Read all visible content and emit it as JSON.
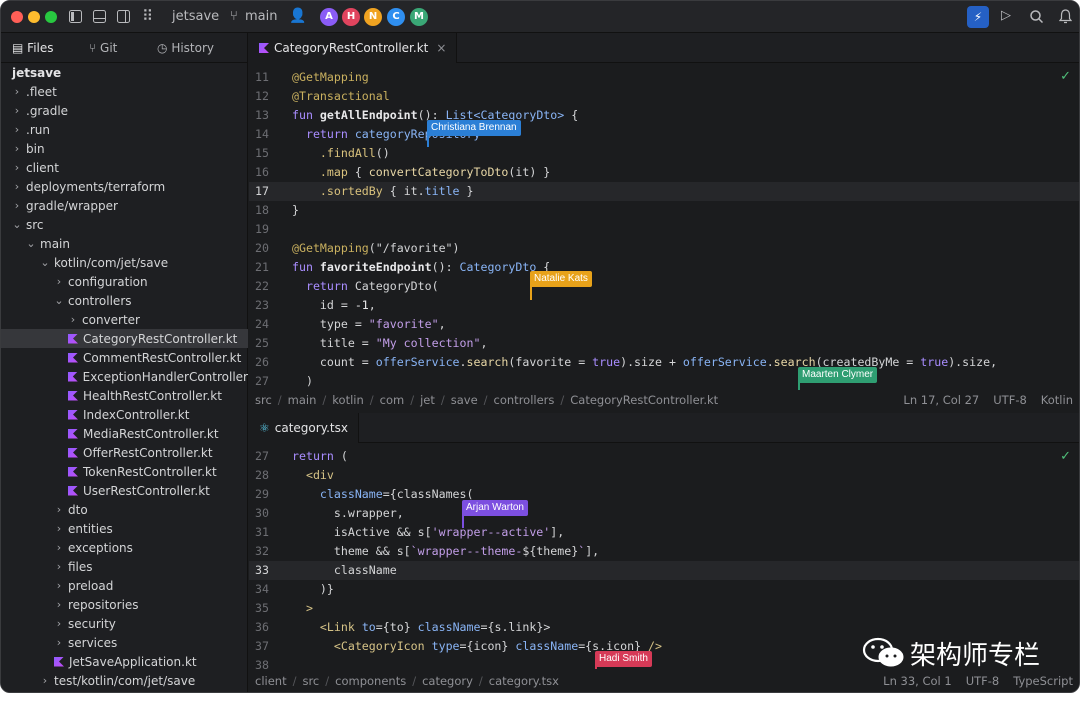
{
  "titlebar": {
    "project": "jetsave",
    "branch": "main",
    "avatars": [
      {
        "letter": "A",
        "color": "#8a5cf6"
      },
      {
        "letter": "H",
        "color": "#e0445e"
      },
      {
        "letter": "N",
        "color": "#f0a321"
      },
      {
        "letter": "C",
        "color": "#2f8ff0"
      },
      {
        "letter": "M",
        "color": "#3aa776"
      }
    ]
  },
  "sidebar": {
    "tabs": [
      "Files",
      "Git",
      "History"
    ],
    "tree": [
      {
        "label": "jetsave",
        "depth": 0,
        "type": "root"
      },
      {
        "label": ".fleet",
        "depth": 0,
        "type": "folder",
        "open": false
      },
      {
        "label": ".gradle",
        "depth": 0,
        "type": "folder",
        "open": false
      },
      {
        "label": ".run",
        "depth": 0,
        "type": "folder",
        "open": false
      },
      {
        "label": "bin",
        "depth": 0,
        "type": "folder",
        "open": false
      },
      {
        "label": "client",
        "depth": 0,
        "type": "folder",
        "open": false
      },
      {
        "label": "deployments/terraform",
        "depth": 0,
        "type": "folder",
        "open": false
      },
      {
        "label": "gradle/wrapper",
        "depth": 0,
        "type": "folder",
        "open": false
      },
      {
        "label": "src",
        "depth": 0,
        "type": "folder",
        "open": true
      },
      {
        "label": "main",
        "depth": 1,
        "type": "folder",
        "open": true
      },
      {
        "label": "kotlin/com/jet/save",
        "depth": 2,
        "type": "folder",
        "open": true
      },
      {
        "label": "configuration",
        "depth": 3,
        "type": "folder",
        "open": false
      },
      {
        "label": "controllers",
        "depth": 3,
        "type": "folder",
        "open": true
      },
      {
        "label": "converter",
        "depth": 4,
        "type": "folder",
        "open": false
      },
      {
        "label": "CategoryRestController.kt",
        "depth": 4,
        "type": "kt",
        "selected": true
      },
      {
        "label": "CommentRestController.kt",
        "depth": 4,
        "type": "kt"
      },
      {
        "label": "ExceptionHandlerController",
        "depth": 4,
        "type": "kt"
      },
      {
        "label": "HealthRestController.kt",
        "depth": 4,
        "type": "kt"
      },
      {
        "label": "IndexController.kt",
        "depth": 4,
        "type": "kt"
      },
      {
        "label": "MediaRestController.kt",
        "depth": 4,
        "type": "kt"
      },
      {
        "label": "OfferRestController.kt",
        "depth": 4,
        "type": "kt"
      },
      {
        "label": "TokenRestController.kt",
        "depth": 4,
        "type": "kt"
      },
      {
        "label": "UserRestController.kt",
        "depth": 4,
        "type": "kt"
      },
      {
        "label": "dto",
        "depth": 3,
        "type": "folder",
        "open": false
      },
      {
        "label": "entities",
        "depth": 3,
        "type": "folder",
        "open": false
      },
      {
        "label": "exceptions",
        "depth": 3,
        "type": "folder",
        "open": false
      },
      {
        "label": "files",
        "depth": 3,
        "type": "folder",
        "open": false
      },
      {
        "label": "preload",
        "depth": 3,
        "type": "folder",
        "open": false
      },
      {
        "label": "repositories",
        "depth": 3,
        "type": "folder",
        "open": false
      },
      {
        "label": "security",
        "depth": 3,
        "type": "folder",
        "open": false
      },
      {
        "label": "services",
        "depth": 3,
        "type": "folder",
        "open": false
      },
      {
        "label": "JetSaveApplication.kt",
        "depth": 3,
        "type": "kt"
      },
      {
        "label": "test/kotlin/com/jet/save",
        "depth": 2,
        "type": "folder",
        "open": false
      }
    ]
  },
  "pane1": {
    "tab": "CategoryRestController.kt",
    "lines": [
      {
        "n": "11",
        "segs": [
          [
            "@GetMapping",
            "a"
          ]
        ]
      },
      {
        "n": "12",
        "segs": [
          [
            "@Transactional",
            "a"
          ]
        ]
      },
      {
        "n": "13",
        "segs": [
          [
            "fun ",
            "k"
          ],
          [
            "getAllEndpoint",
            "fn"
          ],
          [
            "(): ",
            ""
          ],
          [
            "List<CategoryDto>",
            "ty"
          ],
          [
            " {",
            ""
          ]
        ]
      },
      {
        "n": "14",
        "segs": [
          [
            "  return ",
            "k"
          ],
          [
            "categoryRepository",
            "p"
          ]
        ]
      },
      {
        "n": "15",
        "segs": [
          [
            "    .findAll",
            "m"
          ],
          [
            "()",
            ""
          ]
        ]
      },
      {
        "n": "16",
        "segs": [
          [
            "    .map",
            "m"
          ],
          [
            " { ",
            ""
          ],
          [
            "convertCategoryToDto",
            "f"
          ],
          [
            "(it) }",
            ""
          ]
        ]
      },
      {
        "n": "17",
        "segs": [
          [
            "    .sortedBy",
            "m"
          ],
          [
            " { it.",
            ""
          ],
          [
            "title",
            "p"
          ],
          [
            " }",
            ""
          ]
        ],
        "current": true
      },
      {
        "n": "18",
        "segs": [
          [
            "}",
            ""
          ]
        ]
      },
      {
        "n": "19",
        "segs": []
      },
      {
        "n": "20",
        "segs": [
          [
            "@GetMapping",
            "a"
          ],
          [
            "(\"/favorite\")",
            ""
          ]
        ]
      },
      {
        "n": "21",
        "segs": [
          [
            "fun ",
            "k"
          ],
          [
            "favoriteEndpoint",
            "fn"
          ],
          [
            "(): ",
            ""
          ],
          [
            "CategoryDto",
            "ty"
          ],
          [
            " {",
            ""
          ]
        ]
      },
      {
        "n": "22",
        "segs": [
          [
            "  return ",
            "k"
          ],
          [
            "CategoryDto(",
            ""
          ]
        ]
      },
      {
        "n": "23",
        "segs": [
          [
            "    id = ",
            ""
          ],
          [
            "-1",
            "n"
          ],
          [
            ",",
            ""
          ]
        ]
      },
      {
        "n": "24",
        "segs": [
          [
            "    type = ",
            ""
          ],
          [
            "\"favorite\"",
            "s"
          ],
          [
            ",",
            ""
          ]
        ]
      },
      {
        "n": "25",
        "segs": [
          [
            "    title = ",
            ""
          ],
          [
            "\"My collection\"",
            "s"
          ],
          [
            ",",
            ""
          ]
        ]
      },
      {
        "n": "26",
        "segs": [
          [
            "    count = ",
            ""
          ],
          [
            "offerService",
            "p"
          ],
          [
            ".",
            ""
          ],
          [
            "search",
            "f"
          ],
          [
            "(favorite = ",
            ""
          ],
          [
            "true",
            "k"
          ],
          [
            ").size + ",
            ""
          ],
          [
            "offerService",
            "p"
          ],
          [
            ".",
            ""
          ],
          [
            "search",
            "f"
          ],
          [
            "(createdByMe = ",
            ""
          ],
          [
            "true",
            "k"
          ],
          [
            ").size,",
            ""
          ]
        ]
      },
      {
        "n": "27",
        "segs": [
          [
            "  )",
            ""
          ]
        ]
      }
    ],
    "breadcrumb": [
      "src",
      "main",
      "kotlin",
      "com",
      "jet",
      "save",
      "controllers",
      "CategoryRestController.kt"
    ],
    "status": {
      "position": "Ln 17, Col 27",
      "encoding": "UTF-8",
      "language": "Kotlin"
    },
    "collaborators": [
      {
        "name": "Christiana Brennan",
        "color": "#2b7fd6"
      },
      {
        "name": "Natalie Kats",
        "color": "#e8a21a"
      },
      {
        "name": "Maarten Clymer",
        "color": "#2f9e72"
      }
    ]
  },
  "pane2": {
    "tab": "category.tsx",
    "lines": [
      {
        "n": "27",
        "segs": [
          [
            "return ",
            "k"
          ],
          [
            "(",
            ""
          ]
        ]
      },
      {
        "n": "28",
        "segs": [
          [
            "  <div",
            "t"
          ]
        ]
      },
      {
        "n": "29",
        "segs": [
          [
            "    className",
            "p"
          ],
          [
            "={classNames(",
            ""
          ]
        ]
      },
      {
        "n": "30",
        "segs": [
          [
            "      s.wrapper,",
            ""
          ]
        ]
      },
      {
        "n": "31",
        "segs": [
          [
            "      isActive && s[",
            ""
          ],
          [
            "'wrapper--active'",
            "s"
          ],
          [
            "],",
            ""
          ]
        ]
      },
      {
        "n": "32",
        "segs": [
          [
            "      theme && s[",
            ""
          ],
          [
            "`wrapper--theme-",
            "s"
          ],
          [
            "${theme}",
            ""
          ],
          [
            "`",
            "s"
          ],
          [
            "],",
            ""
          ]
        ]
      },
      {
        "n": "33",
        "segs": [
          [
            "      className",
            ""
          ]
        ],
        "current": true
      },
      {
        "n": "34",
        "segs": [
          [
            "    )}",
            ""
          ]
        ]
      },
      {
        "n": "35",
        "segs": [
          [
            "  >",
            "t"
          ]
        ]
      },
      {
        "n": "36",
        "segs": [
          [
            "    <Link ",
            "t"
          ],
          [
            "to",
            "p"
          ],
          [
            "={to} ",
            ""
          ],
          [
            "className",
            "p"
          ],
          [
            "={s.link}>",
            ""
          ]
        ]
      },
      {
        "n": "37",
        "segs": [
          [
            "      <CategoryIcon ",
            "t"
          ],
          [
            "type",
            "p"
          ],
          [
            "={icon} ",
            ""
          ],
          [
            "className",
            "p"
          ],
          [
            "={s.icon} ",
            ""
          ],
          [
            "/>",
            "t"
          ]
        ]
      },
      {
        "n": "38",
        "segs": []
      }
    ],
    "breadcrumb": [
      "client",
      "src",
      "components",
      "category",
      "category.tsx"
    ],
    "status": {
      "position": "Ln 33, Col 1",
      "encoding": "UTF-8",
      "language": "TypeScript"
    },
    "collaborators": [
      {
        "name": "Arjan Warton",
        "color": "#7c4fe0"
      },
      {
        "name": "Hadi Smith",
        "color": "#d63a57"
      }
    ]
  },
  "watermark": "架构师专栏"
}
